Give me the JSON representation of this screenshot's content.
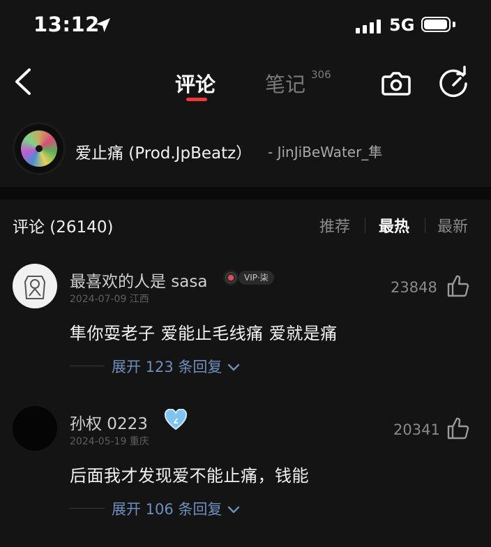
{
  "status_bar": {
    "time": "13:12",
    "network": "5G",
    "icons": [
      "location-arrow-icon",
      "signal-icon",
      "battery-icon"
    ]
  },
  "nav": {
    "tabs": [
      {
        "label": "评论",
        "active": true
      },
      {
        "label": "笔记",
        "count": "306",
        "active": false
      }
    ],
    "icons": [
      "back-chevron-icon",
      "camera-icon",
      "share-icon"
    ],
    "accent_color": "#f2373c"
  },
  "song": {
    "title": "爱止痛 (Prod.JpBeatz）",
    "artist": "- JinJiBeWater_隼"
  },
  "comments_section": {
    "title": "评论 (26140)",
    "sort_options": [
      {
        "label": "推荐",
        "active": false
      },
      {
        "label": "最热",
        "active": true
      },
      {
        "label": "最新",
        "active": false
      }
    ],
    "comments": [
      {
        "username": "最喜欢的人是 sasa",
        "vip_label": "VIP·柒",
        "date_location": "2024-07-09 江西",
        "likes": "23848",
        "text": "隼你耍老子 爱能止毛线痛 爱就是痛",
        "replies_label": "展开 123 条回复"
      },
      {
        "username": "孙权 0223",
        "date_location": "2024-05-19 重庆",
        "likes": "20341",
        "text": "后面我才发现爱不能止痛，钱能",
        "replies_label": "展开 106 条回复"
      }
    ]
  }
}
